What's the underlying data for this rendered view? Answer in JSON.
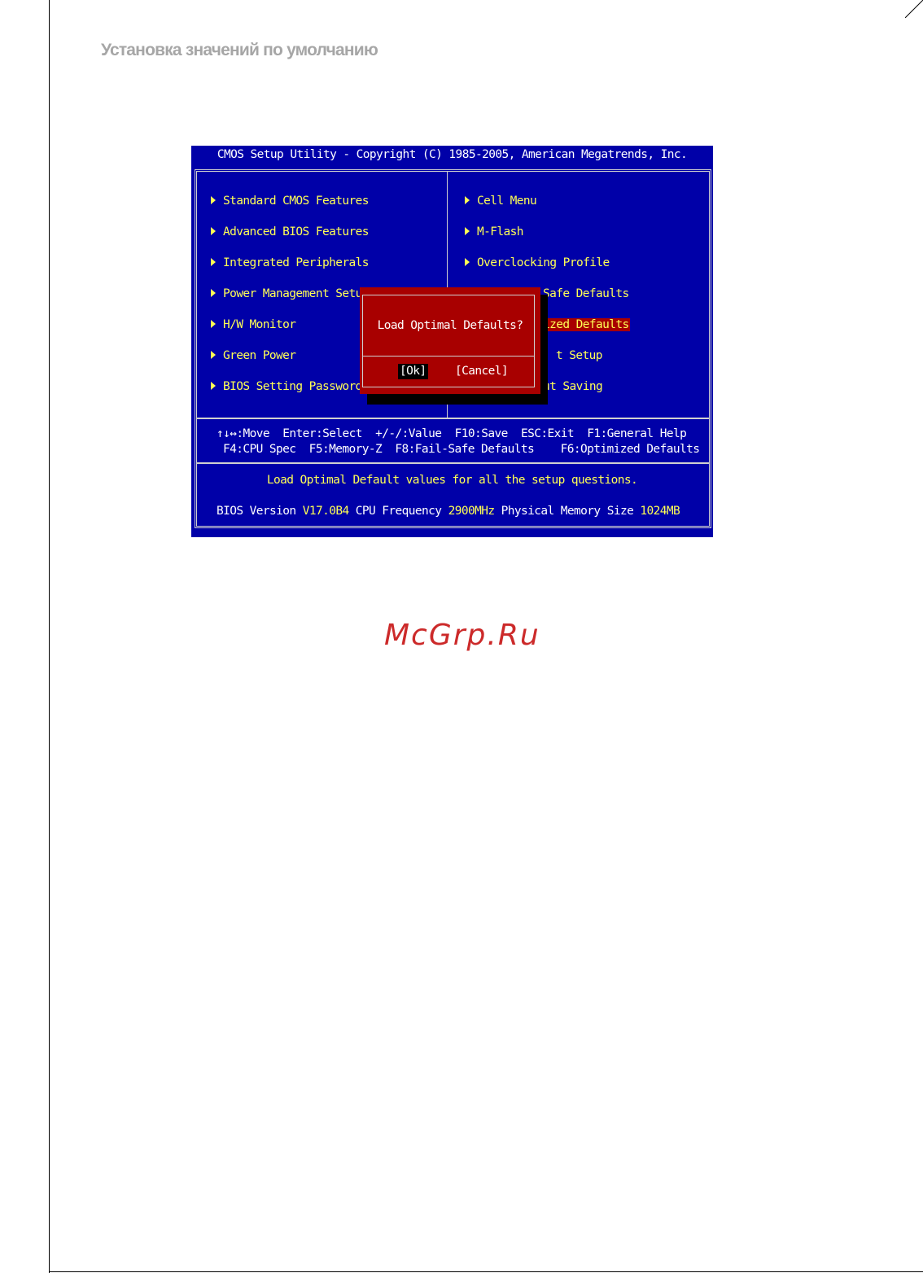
{
  "page": {
    "heading": "Установка значений по умолчанию",
    "watermark": "McGrp.Ru"
  },
  "bios": {
    "title": "CMOS Setup Utility - Copyright (C) 1985-2005, American Megatrends, Inc.",
    "left_menu": [
      "Standard CMOS Features",
      "Advanced BIOS Features",
      "Integrated Peripherals",
      "Power Management Setup",
      "H/W Monitor",
      "Green Power",
      "BIOS Setting Password"
    ],
    "right_menu": [
      "Cell Menu",
      "M-Flash",
      "Overclocking Profile",
      "Load Fail-Safe Defaults",
      "Load Optimized Defaults",
      "Save & Exit Setup",
      "Exit Without Saving"
    ],
    "right_menu_visible": [
      "Cell Menu",
      "M-Flash",
      "Overclocking Profile",
      "Safe Defaults",
      "ized Defaults",
      "t Setup",
      "ut Saving"
    ],
    "selected_item": "Load Optimized Defaults",
    "key_help_line1": "↑↓↔:Move  Enter:Select  +/-/:Value  F10:Save  ESC:Exit  F1:General Help",
    "key_help_line2": "F4:CPU Spec  F5:Memory-Z  F8:Fail-Safe Defaults    F6:Optimized Defaults",
    "help_text": "Load Optimal Default values for all the setup questions.",
    "status": {
      "bios_label": "BIOS Version ",
      "bios_version": "V17.0B4",
      "cpu_label": " CPU Frequency ",
      "cpu_freq": "2900MHz",
      "mem_label": " Physical Memory Size ",
      "mem_size": "1024MB"
    },
    "dialog": {
      "message": "Load Optimal Defaults?",
      "ok_label": "[Ok]",
      "cancel_label": "[Cancel]"
    }
  },
  "colors": {
    "bios_background": "#0000a8",
    "menu_text": "#ffff55",
    "dialog_background": "#a80000",
    "selection_background": "#a80000",
    "heading_gray": "#a6a6a6",
    "watermark_red": "#cc2a2a"
  }
}
